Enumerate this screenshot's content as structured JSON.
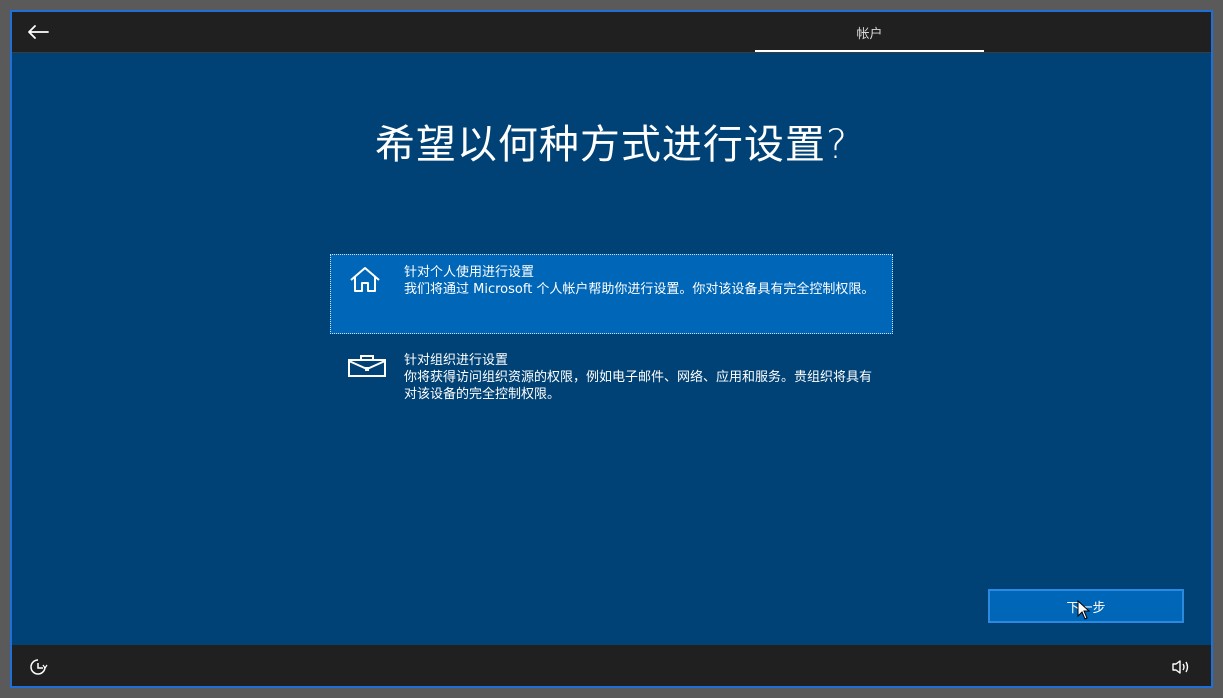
{
  "header": {
    "tab_account": "帐户"
  },
  "main": {
    "title": "希望以何种方式进行设置?",
    "options": [
      {
        "icon": "home-icon",
        "title": "针对个人使用进行设置",
        "desc": "我们将通过 Microsoft 个人帐户帮助你进行设置。你对该设备具有完全控制权限。",
        "selected": true
      },
      {
        "icon": "briefcase-icon",
        "title": "针对组织进行设置",
        "desc": "你将获得访问组织资源的权限，例如电子邮件、网络、应用和服务。贵组织将具有对该设备的完全控制权限。",
        "selected": false
      }
    ],
    "next_label": "下一步"
  },
  "colors": {
    "background": "#004275",
    "selected_option": "#0067b8",
    "bar": "#202020",
    "window_border": "#1f6fd8"
  }
}
